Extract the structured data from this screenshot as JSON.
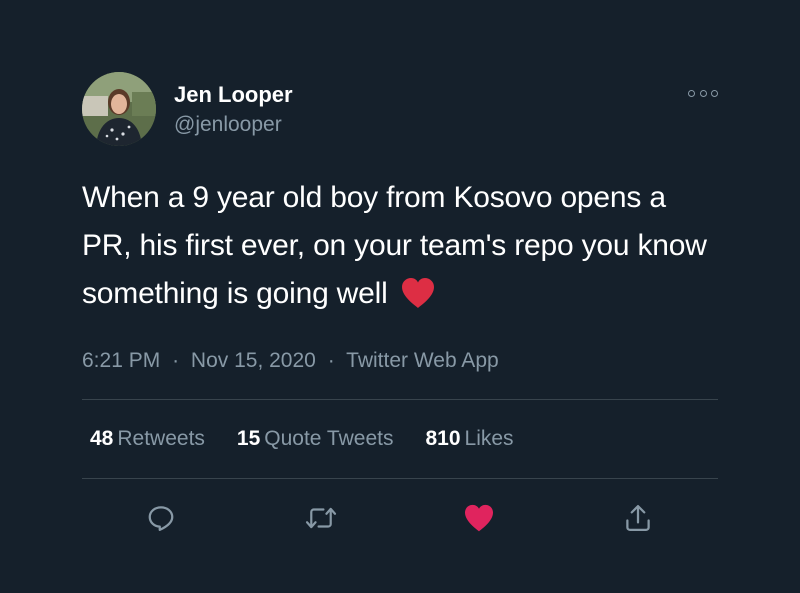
{
  "author": {
    "display_name": "Jen Looper",
    "handle": "@jenlooper",
    "avatar_icon": "profile-photo"
  },
  "more_icon": "more-options-icon",
  "tweet": {
    "text": "When a 9 year old boy from Kosovo opens a PR, his first ever, on your team's repo you know something is going well",
    "emoji": "red-heart"
  },
  "meta": {
    "time": "6:21 PM",
    "date": "Nov 15, 2020",
    "source": "Twitter Web App",
    "separator": "·"
  },
  "stats": {
    "retweets_count": "48",
    "retweets_label": "Retweets",
    "quotes_count": "15",
    "quotes_label": "Quote Tweets",
    "likes_count": "810",
    "likes_label": "Likes"
  },
  "actions": {
    "reply_icon": "reply-icon",
    "retweet_icon": "retweet-icon",
    "like_icon": "like-icon",
    "share_icon": "share-icon",
    "liked": true
  },
  "colors": {
    "background": "#15202b",
    "text": "#ffffff",
    "secondary": "#8899a6",
    "divider": "#38444d",
    "like": "#e0245e",
    "heart_emoji": "#dd2e44"
  }
}
